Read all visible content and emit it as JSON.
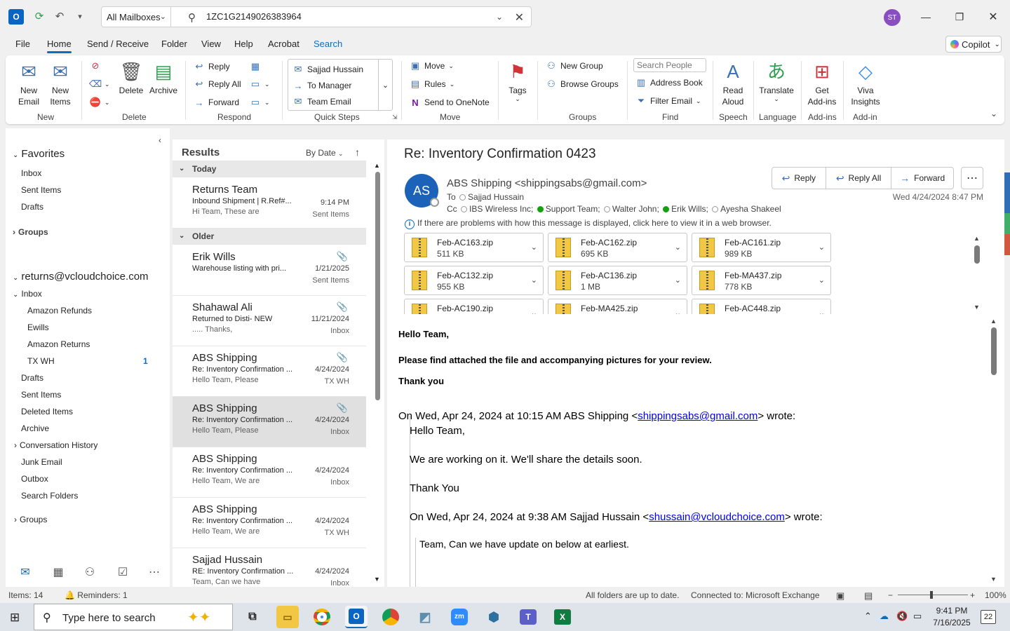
{
  "titlebar": {
    "mailbox_select": "All Mailboxes",
    "search_value": "1ZC1G2149026383964",
    "avatar_initials": "ST"
  },
  "menu": {
    "tabs": [
      "File",
      "Home",
      "Send / Receive",
      "Folder",
      "View",
      "Help",
      "Acrobat",
      "Search"
    ],
    "active": "Home",
    "copilot": "Copilot"
  },
  "ribbon": {
    "new_email": "New\nEmail",
    "new_items": "New\nItems",
    "delete": "Delete",
    "archive": "Archive",
    "reply": "Reply",
    "reply_all": "Reply All",
    "forward": "Forward",
    "quick_steps": [
      "Sajjad Hussain",
      "To Manager",
      "Team Email"
    ],
    "move": "Move",
    "rules": "Rules",
    "send_to_onenote": "Send to OneNote",
    "tags": "Tags",
    "new_group": "New Group",
    "browse_groups": "Browse Groups",
    "search_people_placeholder": "Search People",
    "address_book": "Address Book",
    "filter_email": "Filter Email",
    "read_aloud": "Read\nAloud",
    "translate": "Translate",
    "get_addins": "Get\nAdd-ins",
    "viva_insights": "Viva\nInsights",
    "groups": [
      "New",
      "Delete",
      "Respond",
      "Quick Steps",
      "Move",
      "Groups",
      "Find",
      "Speech",
      "Language",
      "Add-ins",
      "Add-in"
    ]
  },
  "folders": {
    "favorites_label": "Favorites",
    "favorites": [
      "Inbox",
      "Sent Items",
      "Drafts"
    ],
    "groups_label": "Groups",
    "account": "returns@vcloudchoice.com",
    "inbox": "Inbox",
    "inbox_sub": [
      "Amazon Refunds",
      "Ewills",
      "Amazon Returns",
      "TX WH"
    ],
    "txwh_count": "1",
    "others": [
      "Drafts",
      "Sent Items",
      "Deleted Items",
      "Archive",
      "Conversation History",
      "Junk Email",
      "Outbox",
      "Search Folders"
    ],
    "groups_label2": "Groups"
  },
  "message_list": {
    "header": "Results",
    "sort": "By Date",
    "group_today": "Today",
    "group_older": "Older",
    "messages": [
      {
        "sender": "Returns Team",
        "subject": "Inbound Shipment | R.Ref#...",
        "preview": "Hi Team,  These are",
        "date": "9:14 PM",
        "folder": "Sent Items",
        "attach": false
      },
      {
        "sender": "Erik Wills",
        "subject": "Warehouse listing with pri...",
        "preview": "",
        "date": "1/21/2025",
        "folder": "Sent Items",
        "attach": true
      },
      {
        "sender": "Shahawal Ali",
        "subject": "Returned to Disti- NEW",
        "preview": "..... Thanks,",
        "date": "11/21/2024",
        "folder": "Inbox",
        "attach": true
      },
      {
        "sender": "ABS Shipping",
        "subject": "Re: Inventory Confirmation ...",
        "preview": "Hello Team,  Please",
        "date": "4/24/2024",
        "folder": "TX WH",
        "attach": true
      },
      {
        "sender": "ABS Shipping",
        "subject": "Re: Inventory Confirmation ...",
        "preview": "Hello Team,  Please",
        "date": "4/24/2024",
        "folder": "Inbox",
        "attach": true
      },
      {
        "sender": "ABS Shipping",
        "subject": "Re: Inventory Confirmation ...",
        "preview": "Hello Team,  We are",
        "date": "4/24/2024",
        "folder": "Inbox",
        "attach": false
      },
      {
        "sender": "ABS Shipping",
        "subject": "Re: Inventory Confirmation ...",
        "preview": "Hello Team,  We are",
        "date": "4/24/2024",
        "folder": "TX WH",
        "attach": false
      },
      {
        "sender": "Sajjad Hussain",
        "subject": "RE: Inventory Confirmation ...",
        "preview": "Team, Can we have",
        "date": "4/24/2024",
        "folder": "Inbox",
        "attach": false
      }
    ]
  },
  "reading": {
    "subject": "Re: Inventory Confirmation 0423",
    "avatar": "AS",
    "from": "ABS Shipping <shippingsabs@gmail.com>",
    "to_label": "To",
    "to": "Sajjad Hussain",
    "cc_label": "Cc",
    "cc": [
      "IBS Wireless Inc;",
      "Support Team;",
      "Walter John;",
      "Erik Wills;",
      "Ayesha Shakeel"
    ],
    "reply": "Reply",
    "reply_all": "Reply All",
    "forward": "Forward",
    "date": "Wed 4/24/2024 8:47 PM",
    "info": "If there are problems with how this message is displayed, click here to view it in a web browser.",
    "attachments": [
      {
        "name": "Feb-AC163.zip",
        "size": "511 KB"
      },
      {
        "name": "Feb-AC162.zip",
        "size": "695 KB"
      },
      {
        "name": "Feb-AC161.zip",
        "size": "989 KB"
      },
      {
        "name": "Feb-AC132.zip",
        "size": "955 KB"
      },
      {
        "name": "Feb-AC136.zip",
        "size": "1 MB"
      },
      {
        "name": "Feb-MA437.zip",
        "size": "778 KB"
      },
      {
        "name": "Feb-AC190.zip",
        "size": ""
      },
      {
        "name": "Feb-MA425.zip",
        "size": ""
      },
      {
        "name": "Feb-AC448.zip",
        "size": ""
      }
    ],
    "body": {
      "greeting": "Hello Team,",
      "line1": "Please find attached the file and accompanying pictures for your review.",
      "thanks": "Thank you",
      "quote1_header_pre": "On Wed, Apr 24, 2024 at 10:15 AM ABS Shipping <",
      "quote1_email": "shippingsabs@gmail.com",
      "quote1_header_post": "> wrote:",
      "quote1_greeting": "Hello Team,",
      "quote1_line": "We are working on it. We'll share the details soon.",
      "quote1_thanks": "Thank You",
      "quote2_header_pre": "On Wed, Apr 24, 2024 at 9:38 AM Sajjad Hussain <",
      "quote2_email": "shussain@vcloudchoice.com",
      "quote2_header_post": "> wrote:",
      "quote2_line": "Team, Can we have update on below at earliest."
    }
  },
  "statusbar": {
    "items": "Items: 14",
    "reminders": "Reminders: 1",
    "folders_status": "All folders are up to date.",
    "connection": "Connected to: Microsoft Exchange",
    "zoom": "100%"
  },
  "taskbar": {
    "search_placeholder": "Type here to search",
    "time": "9:41 PM",
    "date": "7/16/2025",
    "notifications": "22"
  }
}
